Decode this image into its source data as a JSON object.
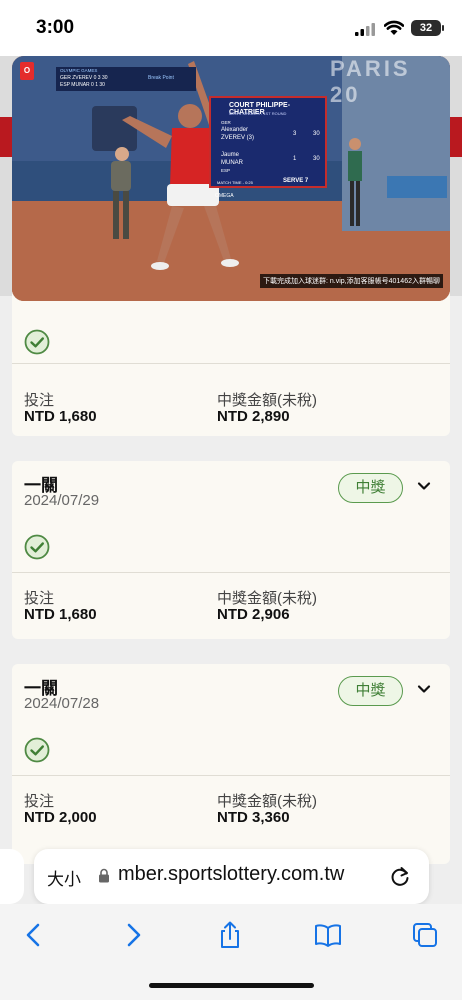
{
  "status_bar": {
    "time": "3:00",
    "battery": "32"
  },
  "cards": [
    {
      "type": "",
      "date": "",
      "badge": "",
      "bet_label": "投注",
      "bet_value": "NTD 1,680",
      "payout_label": "中獎金額(未稅)",
      "payout_value": "NTD 2,890"
    },
    {
      "type": "一關",
      "date": "2024/07/29",
      "badge": "中獎",
      "bet_label": "投注",
      "bet_value": "NTD 1,680",
      "payout_label": "中獎金額(未稅)",
      "payout_value": "NTD 2,906"
    },
    {
      "type": "一關",
      "date": "2024/07/28",
      "badge": "中獎",
      "bet_label": "投注",
      "bet_value": "NTD 2,000",
      "payout_label": "中獎金額(未稅)",
      "payout_value": "NTD 3,360"
    }
  ],
  "video": {
    "caption": "下載完成加入球迷群: n.vip,添加客服帳号401462入群暢聊",
    "paris": "PARIS 20",
    "score_panel": {
      "title": "COURT PHILIPPE-CHATRIER",
      "subtitle": "MEN'S SINGLES - 1ST ROUND",
      "p1_country": "GER",
      "p1_name": "Alexander",
      "p1_name2": "ZVEREV (3)",
      "p1_s1": "3",
      "p1_s2": "30",
      "p2_country": "ESP",
      "p2_name": "Jaume",
      "p2_name2": "MUNAR",
      "p2_s1": "1",
      "p2_s2": "30",
      "serve": "SERVE  7",
      "match_time": "MATCH TIME - 0:25",
      "omega": "OMEGA"
    },
    "mini": {
      "title": "OLYMPIC GAMES",
      "row1": "GER  ZVEREV  0  3  30",
      "row2": "ESP  MUNAR  0  1  30",
      "break": "Break Point"
    }
  },
  "address_bar": {
    "text_size": "大小",
    "url": "mber.sportslottery.com.tw"
  },
  "colors": {
    "accent_green": "#3f7f35",
    "header_red": "#b9191f"
  },
  "icons": [
    "signal-icon",
    "wifi-icon",
    "check-icon",
    "chevron-down-icon",
    "lock-icon",
    "reload-icon",
    "back-icon",
    "forward-icon",
    "share-icon",
    "bookmarks-icon",
    "tabs-icon"
  ]
}
